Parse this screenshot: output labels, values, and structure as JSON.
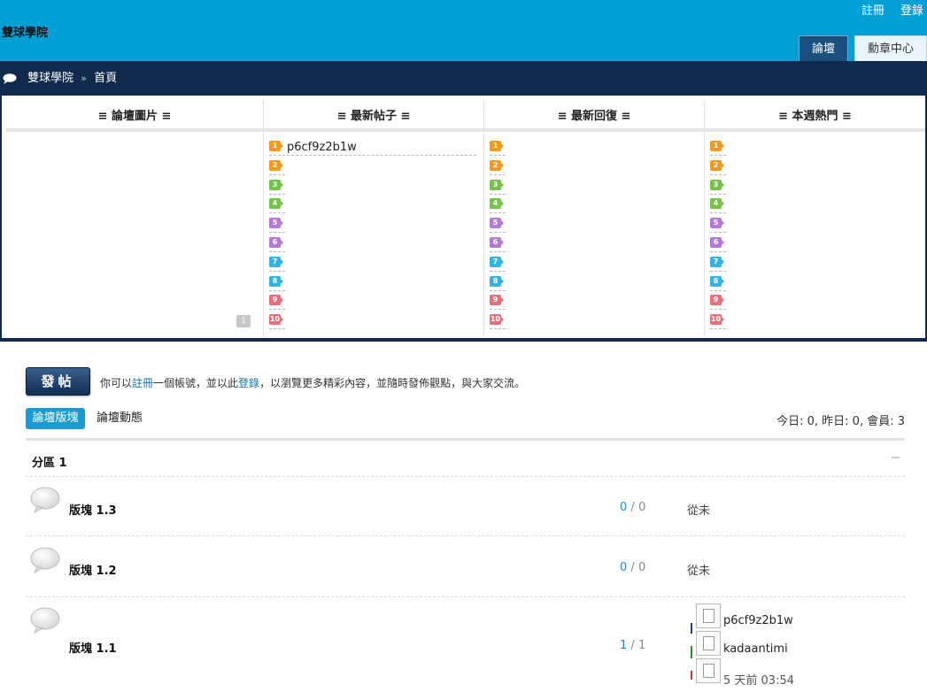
{
  "header": {
    "site_title": "雙球學院",
    "top_links": [
      "註冊",
      "登錄"
    ],
    "nav_tabs": [
      "論壇",
      "勳章中心"
    ]
  },
  "breadcrumb": {
    "home": "雙球學院",
    "separator": "»",
    "current": "首頁"
  },
  "panel": {
    "columns": [
      "≡ 論壇圖片 ≡",
      "≡ 最新帖子 ≡",
      "≡ 最新回復 ≡",
      "≡ 本週熱門 ≡"
    ],
    "latest_post_title": "p6cf9z2b1w",
    "pager_label": "1",
    "rank_numbers": [
      "1",
      "2",
      "3",
      "4",
      "5",
      "6",
      "7",
      "8",
      "9",
      "10"
    ],
    "rank_colors": [
      "#f29a1f",
      "#f29a1f",
      "#77c24a",
      "#77c24a",
      "#b57ad6",
      "#b57ad6",
      "#34b3e0",
      "#34b3e0",
      "#e9707a",
      "#e9707a"
    ]
  },
  "post_bar": {
    "button": "發帖",
    "hint_before": "你可以",
    "register": "註冊",
    "hint_mid": "一個帳號，並以此",
    "login": "登錄",
    "hint_after": "，以瀏覽更多精彩內容，並隨時發佈觀點，與大家交流。"
  },
  "tabs": {
    "active": "論壇版塊",
    "other": "論壇動態"
  },
  "stats": "今日: 0, 昨日: 0, 會員: 3",
  "category": {
    "title": "分區 1"
  },
  "forums": [
    {
      "name": "版塊 1.3",
      "topics": "0",
      "slash": " / ",
      "posts": "0",
      "last": "從未"
    },
    {
      "name": "版塊 1.2",
      "topics": "0",
      "slash": " / ",
      "posts": "0",
      "last": "從未"
    },
    {
      "name": "版塊 1.1",
      "topics": "1",
      "slash": " / ",
      "posts": "1",
      "last": ""
    }
  ],
  "last_post": {
    "title": "p6cf9z2b1w",
    "author": "kadaantimi",
    "time": "5 天前 03:54"
  },
  "colors": {
    "header": "#009fd4",
    "navy": "#102a4c",
    "accent": "#1d9bd1"
  }
}
